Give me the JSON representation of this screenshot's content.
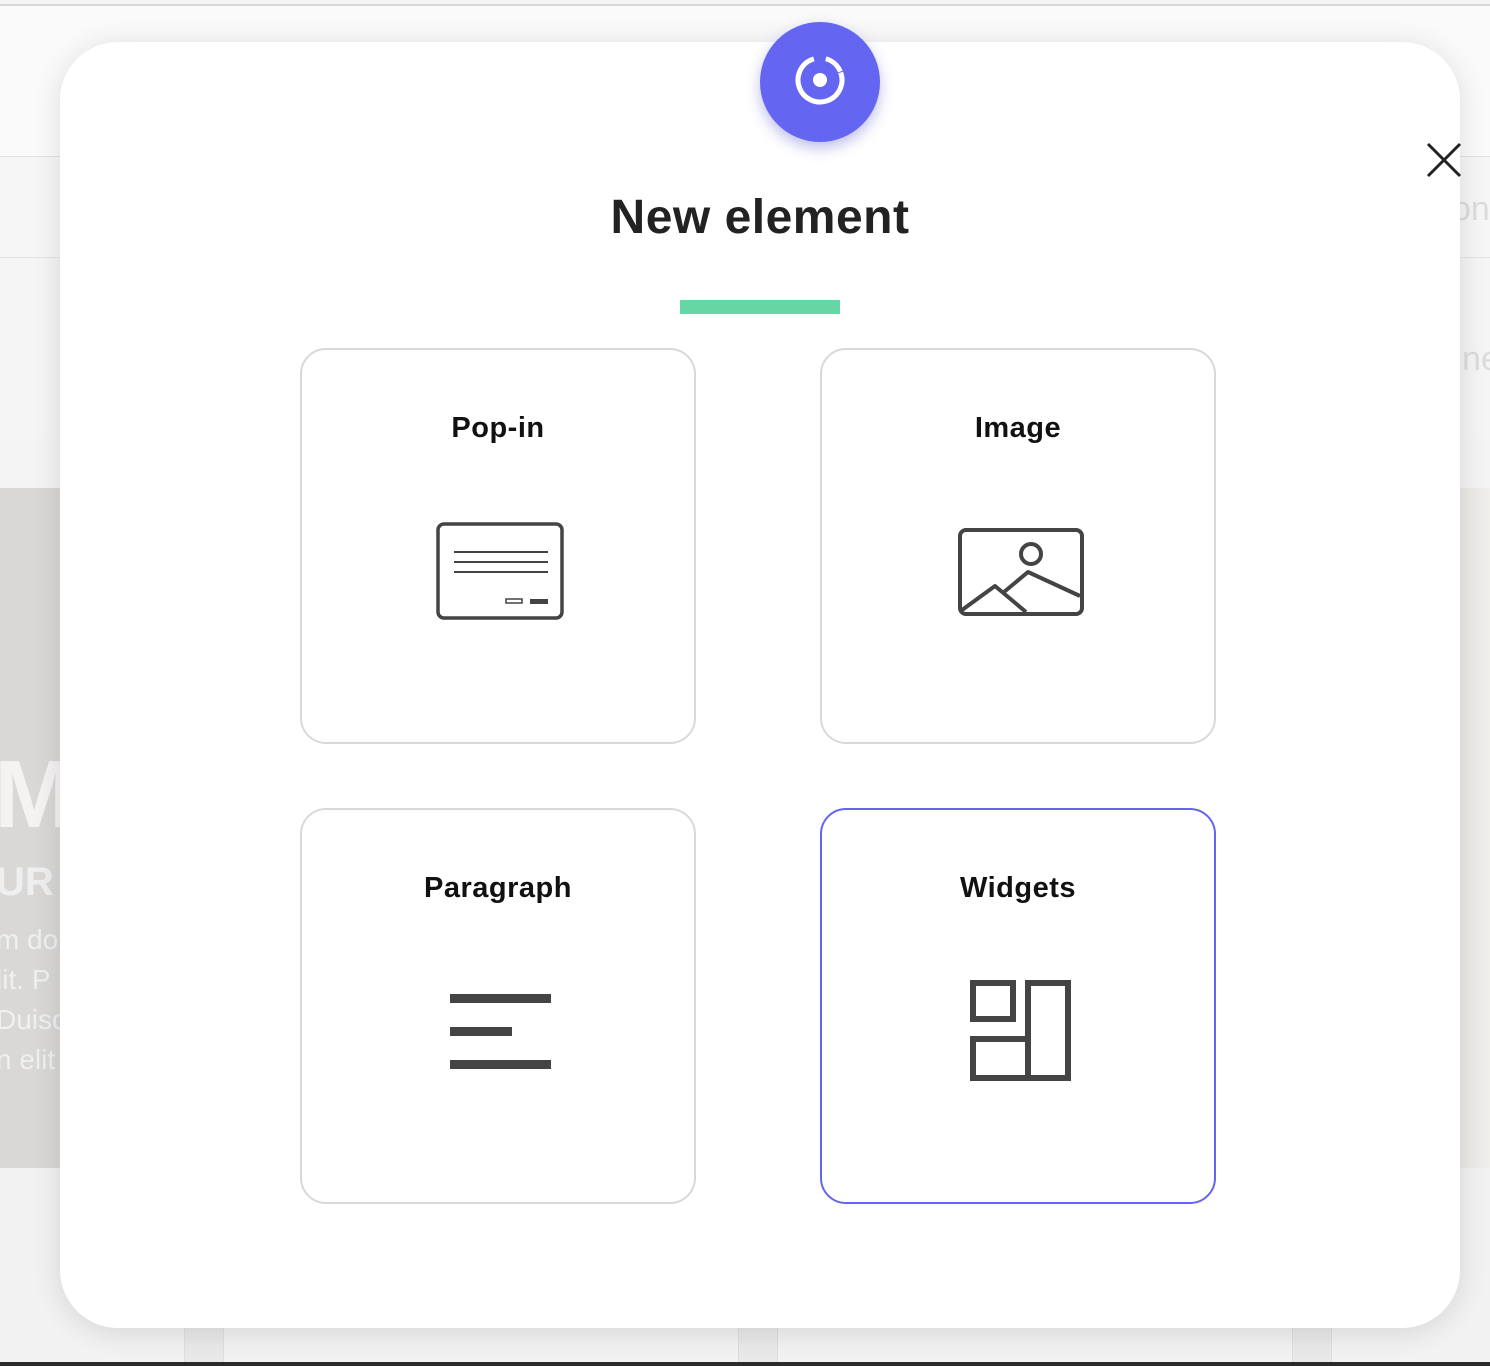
{
  "background": {
    "hero_heading": "MI",
    "hero_subheading": "UR",
    "hero_text_lines": [
      "m do",
      "lit. P",
      "Duisq",
      "n elit"
    ],
    "right_fragment_1": "on",
    "right_fragment_2": "ne"
  },
  "modal": {
    "badge_icon": "target-icon",
    "close_icon": "close-icon",
    "title": "New element",
    "accent_color": "#6466f1",
    "underline_color": "#64d7a5",
    "options": [
      {
        "label": "Pop-in",
        "icon": "popin-icon",
        "selected": false
      },
      {
        "label": "Image",
        "icon": "image-icon",
        "selected": false
      },
      {
        "label": "Paragraph",
        "icon": "paragraph-icon",
        "selected": false
      },
      {
        "label": "Widgets",
        "icon": "widgets-icon",
        "selected": true
      }
    ]
  }
}
